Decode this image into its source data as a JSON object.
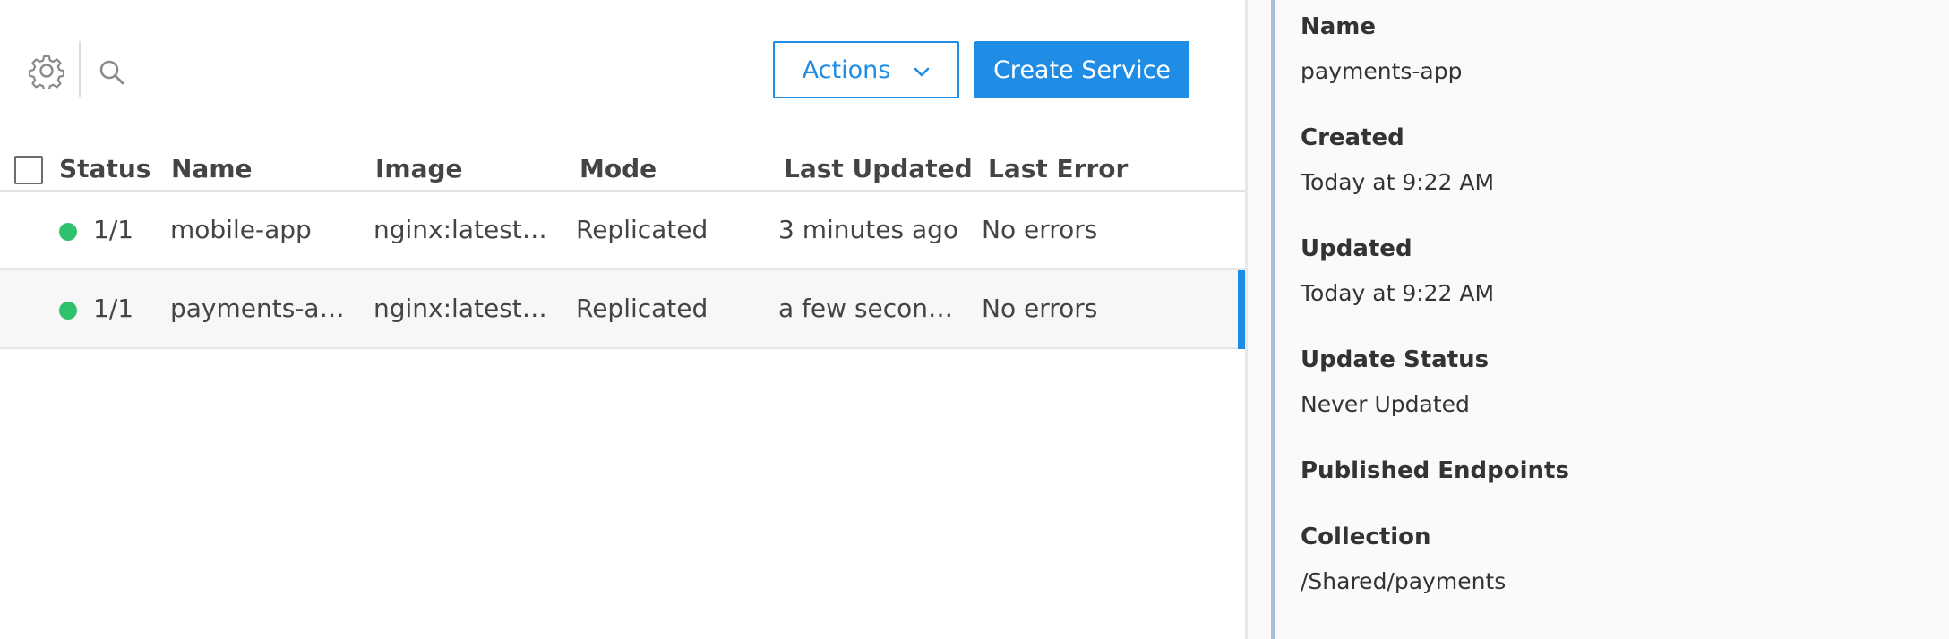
{
  "toolbar": {
    "settings_icon": "gear-icon",
    "search_icon": "search-icon",
    "actions_label": "Actions",
    "actions_icon": "chevron-down-icon",
    "create_label": "Create Service"
  },
  "table": {
    "columns": [
      "Status",
      "Name",
      "Image",
      "Mode",
      "Last Updated",
      "Last Error"
    ],
    "rows": [
      {
        "status_color": "#2ec26c",
        "status": "1/1",
        "name": "mobile-app",
        "image": "nginx:latest@...",
        "mode": "Replicated",
        "last_updated": "3 minutes ago",
        "last_error": "No errors"
      },
      {
        "status_color": "#2ec26c",
        "status": "1/1",
        "name": "payments-app",
        "image": "nginx:latest@...",
        "mode": "Replicated",
        "last_updated": "a few seconds...",
        "last_error": "No errors",
        "selected": true
      }
    ]
  },
  "details": {
    "name_label": "Name",
    "name_value": "payments-app",
    "created_label": "Created",
    "created_value": "Today at 9:22 AM",
    "updated_label": "Updated",
    "updated_value": "Today at 9:22 AM",
    "update_status_label": "Update Status",
    "update_status_value": "Never Updated",
    "endpoints_label": "Published Endpoints",
    "collection_label": "Collection",
    "collection_value": "/Shared/payments"
  },
  "colors": {
    "accent": "#1f8ce6",
    "status_ok": "#2ec26c"
  }
}
